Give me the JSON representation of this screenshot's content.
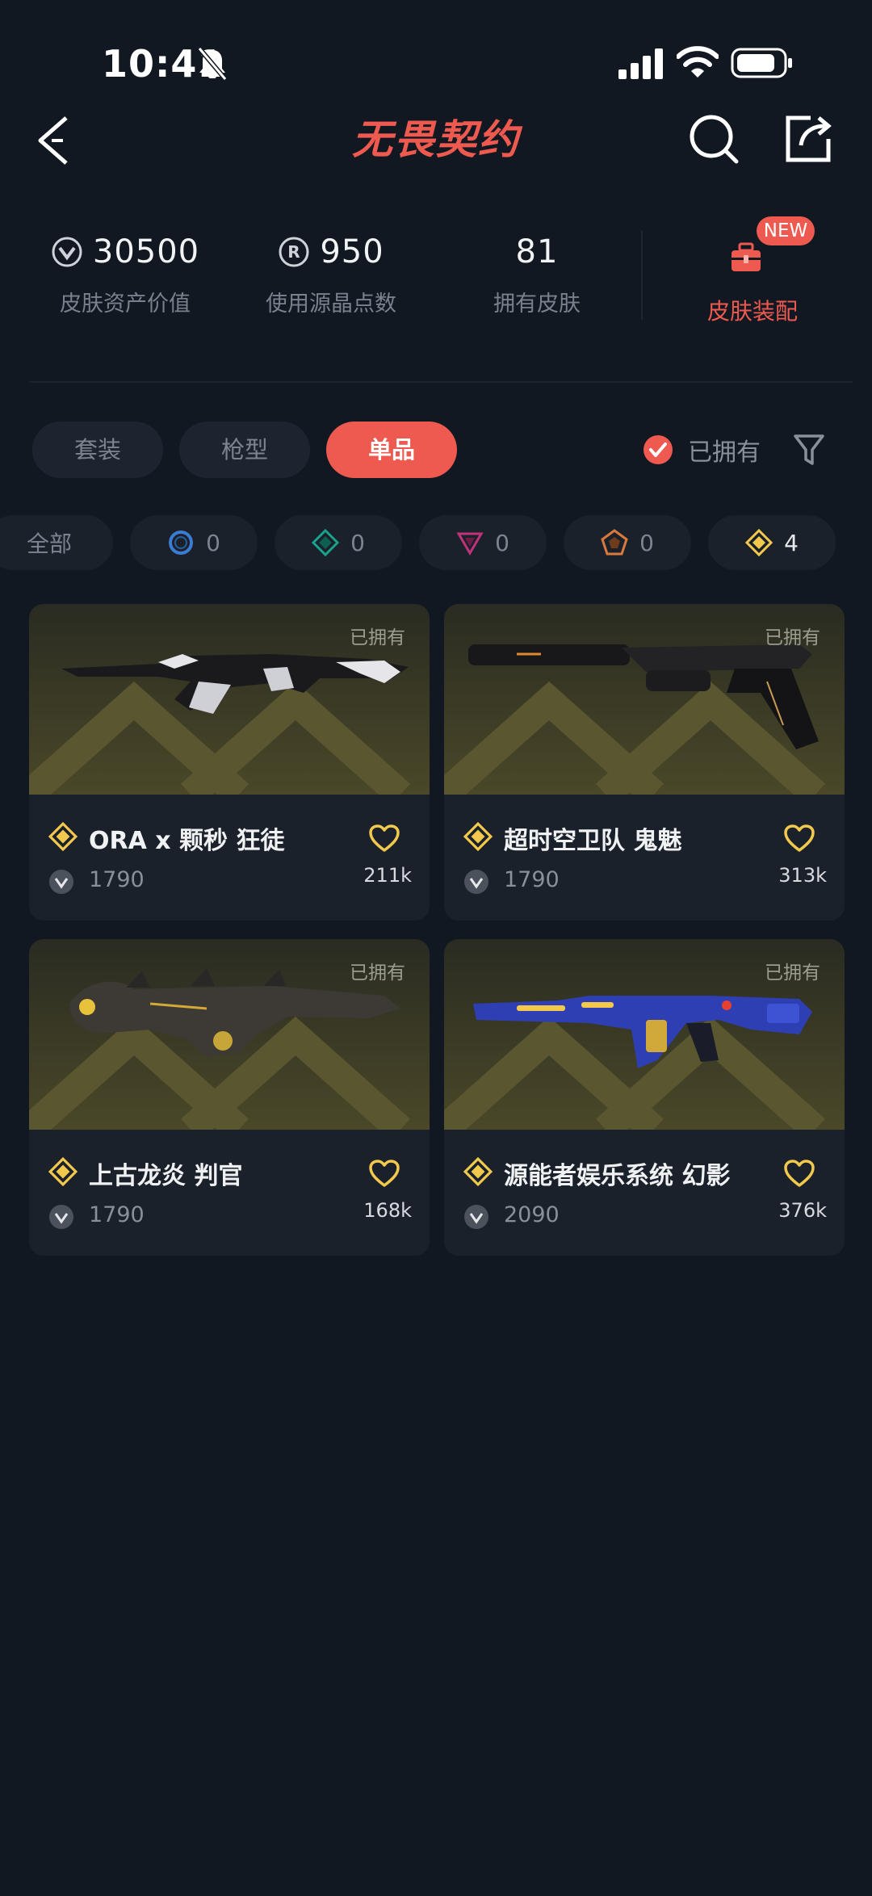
{
  "status_bar": {
    "time": "10:41"
  },
  "header": {
    "title": "无畏契约"
  },
  "stats": [
    {
      "value": "30500",
      "label": "皮肤资产价值",
      "icon": "vp-coin-icon"
    },
    {
      "value": "950",
      "label": "使用源晶点数",
      "icon": "radianite-icon"
    },
    {
      "value": "81",
      "label": "拥有皮肤"
    }
  ],
  "outfit": {
    "label": "皮肤装配",
    "badge": "NEW"
  },
  "category_tabs": [
    {
      "label": "套装",
      "active": false
    },
    {
      "label": "枪型",
      "active": false
    },
    {
      "label": "单品",
      "active": true
    }
  ],
  "owned_filter": {
    "label": "已拥有",
    "checked": true
  },
  "tier_chips": [
    {
      "label": "全部"
    },
    {
      "count": "0",
      "icon": "select-tier-icon",
      "color": "#3b7bd1"
    },
    {
      "count": "0",
      "icon": "deluxe-tier-icon",
      "color": "#1aa38a"
    },
    {
      "count": "0",
      "icon": "premium-tier-icon",
      "color": "#c0327a"
    },
    {
      "count": "0",
      "icon": "exclusive-tier-icon",
      "color": "#d97a3c"
    },
    {
      "count": "4",
      "icon": "ultra-tier-icon",
      "color": "#f2c94c",
      "selected": true
    }
  ],
  "skins": [
    {
      "name": "ORA x 颗秒 狂徒",
      "price": "1790",
      "likes": "211k",
      "owned_label": "已拥有"
    },
    {
      "name": "超时空卫队 鬼魅",
      "price": "1790",
      "likes": "313k",
      "owned_label": "已拥有"
    },
    {
      "name": "上古龙炎 判官",
      "price": "1790",
      "likes": "168k",
      "owned_label": "已拥有"
    },
    {
      "name": "源能者娱乐系统 幻影",
      "price": "2090",
      "likes": "376k",
      "owned_label": "已拥有"
    }
  ],
  "colors": {
    "accent": "#ee5a4f",
    "background": "#111821",
    "card": "#1a212b",
    "tier_gold": "#f2c94c"
  }
}
